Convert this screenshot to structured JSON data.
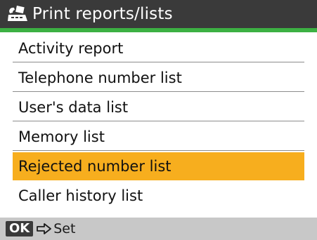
{
  "header": {
    "icon": "fax-machine-icon",
    "title": "Print reports/lists"
  },
  "menu": {
    "items": [
      {
        "label": "Activity report",
        "selected": false
      },
      {
        "label": "Telephone number list",
        "selected": false
      },
      {
        "label": "User's data list",
        "selected": false
      },
      {
        "label": "Memory list",
        "selected": false
      },
      {
        "label": "Rejected number list",
        "selected": true
      },
      {
        "label": "Caller history list",
        "selected": false
      }
    ]
  },
  "footer": {
    "ok_label": "OK",
    "arrow_icon": "arrow-right-icon",
    "action_label": "Set"
  },
  "colors": {
    "title_bar": "#3a3a3a",
    "accent_rule": "#3cb043",
    "selection": "#f7ae1e",
    "footer_bar": "#c8c8c8"
  }
}
